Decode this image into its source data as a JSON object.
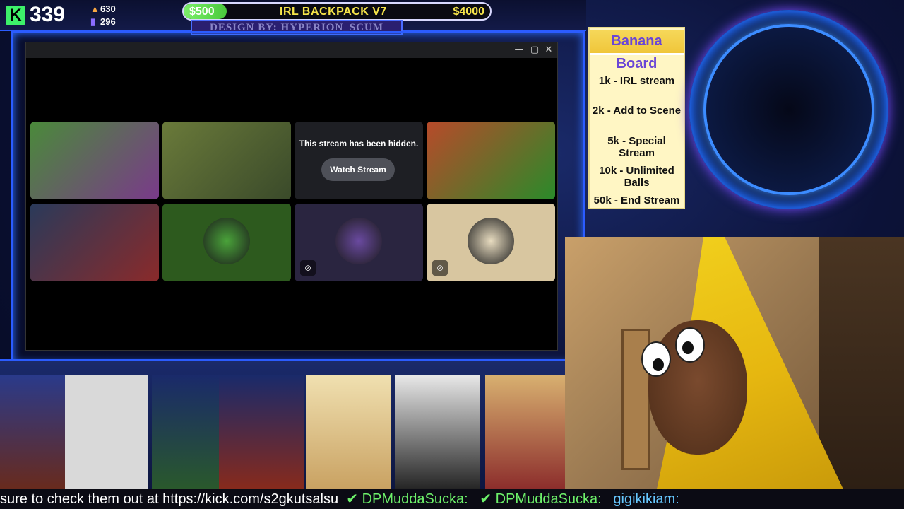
{
  "header": {
    "logo_letter": "K",
    "viewer_count": "339",
    "stat_top": "630",
    "stat_bottom": "296",
    "goal_start": "$500",
    "goal_title": "IRL BACKPACK V7",
    "goal_end": "$4000",
    "goal_progress": 0.14,
    "design_credit": "DESIGN BY: HYPERION_SCUM"
  },
  "window": {
    "controls": {
      "minimize": "—",
      "maximize": "▢",
      "close": "✕"
    },
    "tiles": [
      {
        "kind": "screen",
        "colors": [
          "#4a8a3a",
          "#7a3a8a"
        ]
      },
      {
        "kind": "screen",
        "colors": [
          "#6a7a3a",
          "#3a4a2a"
        ]
      },
      {
        "kind": "hidden",
        "message": "This stream has been hidden.",
        "button": "Watch Stream"
      },
      {
        "kind": "screen",
        "colors": [
          "#b84a2a",
          "#2a8a2a"
        ]
      },
      {
        "kind": "screen",
        "colors": [
          "#2a3a5a",
          "#8a2a2a"
        ]
      },
      {
        "kind": "avatar",
        "bg": "#2d5a1e",
        "avatar": "#4aa33a",
        "muted": false
      },
      {
        "kind": "avatar",
        "bg": "#2a2540",
        "avatar": "#6a4aa0",
        "muted": true
      },
      {
        "kind": "avatar",
        "bg": "#d8c6a0",
        "avatar": "#e8dcc0",
        "muted": true
      }
    ]
  },
  "banana_board": {
    "title": "Banana Board",
    "items": [
      "1k - IRL stream",
      "2k - Add to Scene",
      "5k - Special Stream",
      "10k - Unlimited Balls",
      "50k - End Stream"
    ]
  },
  "ticker": {
    "text1": "sure to check them out at https://kick.com/s2gkutsalsu",
    "user1": "DPMuddaSucka:",
    "user2": "DPMuddaSucka:",
    "user3": "gigikikiam:"
  },
  "colors": {
    "accent": "#2b5cff",
    "goal_fill": "#7cf06a",
    "banana": "#f2d21e"
  }
}
